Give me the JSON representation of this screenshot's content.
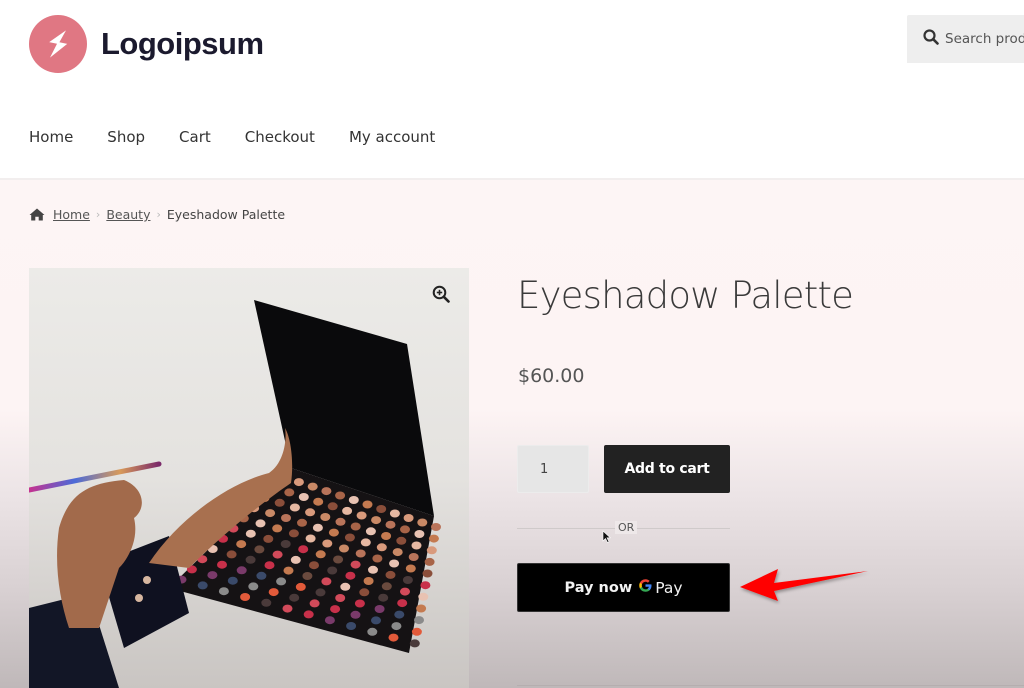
{
  "site": {
    "logo_text": "Logoipsum",
    "logo_icon": "lightning-bolt-icon",
    "brand_color": "#e07783"
  },
  "search": {
    "placeholder": "Search products…",
    "icon": "search-icon"
  },
  "nav": {
    "items": [
      {
        "label": "Home"
      },
      {
        "label": "Shop"
      },
      {
        "label": "Cart"
      },
      {
        "label": "Checkout"
      },
      {
        "label": "My account"
      }
    ]
  },
  "breadcrumb": {
    "icon": "home-icon",
    "items": [
      {
        "label": "Home",
        "link": true
      },
      {
        "label": "Beauty",
        "link": true
      },
      {
        "label": "Eyeshadow Palette",
        "link": false
      }
    ],
    "separator": "›"
  },
  "product": {
    "title": "Eyeshadow Palette",
    "price": "$60.00",
    "image_alt": "Hands holding an open eyeshadow palette with a makeup brush",
    "zoom_icon": "zoom-in-icon",
    "quantity": "1",
    "add_to_cart_label": "Add to cart",
    "or_label": "OR",
    "pay_now_label": "Pay now",
    "gpay_label": "Pay",
    "gpay_icon": "google-g-icon"
  },
  "annotation": {
    "arrow_color": "#ff0000",
    "arrow_target": "pay-now-button"
  }
}
